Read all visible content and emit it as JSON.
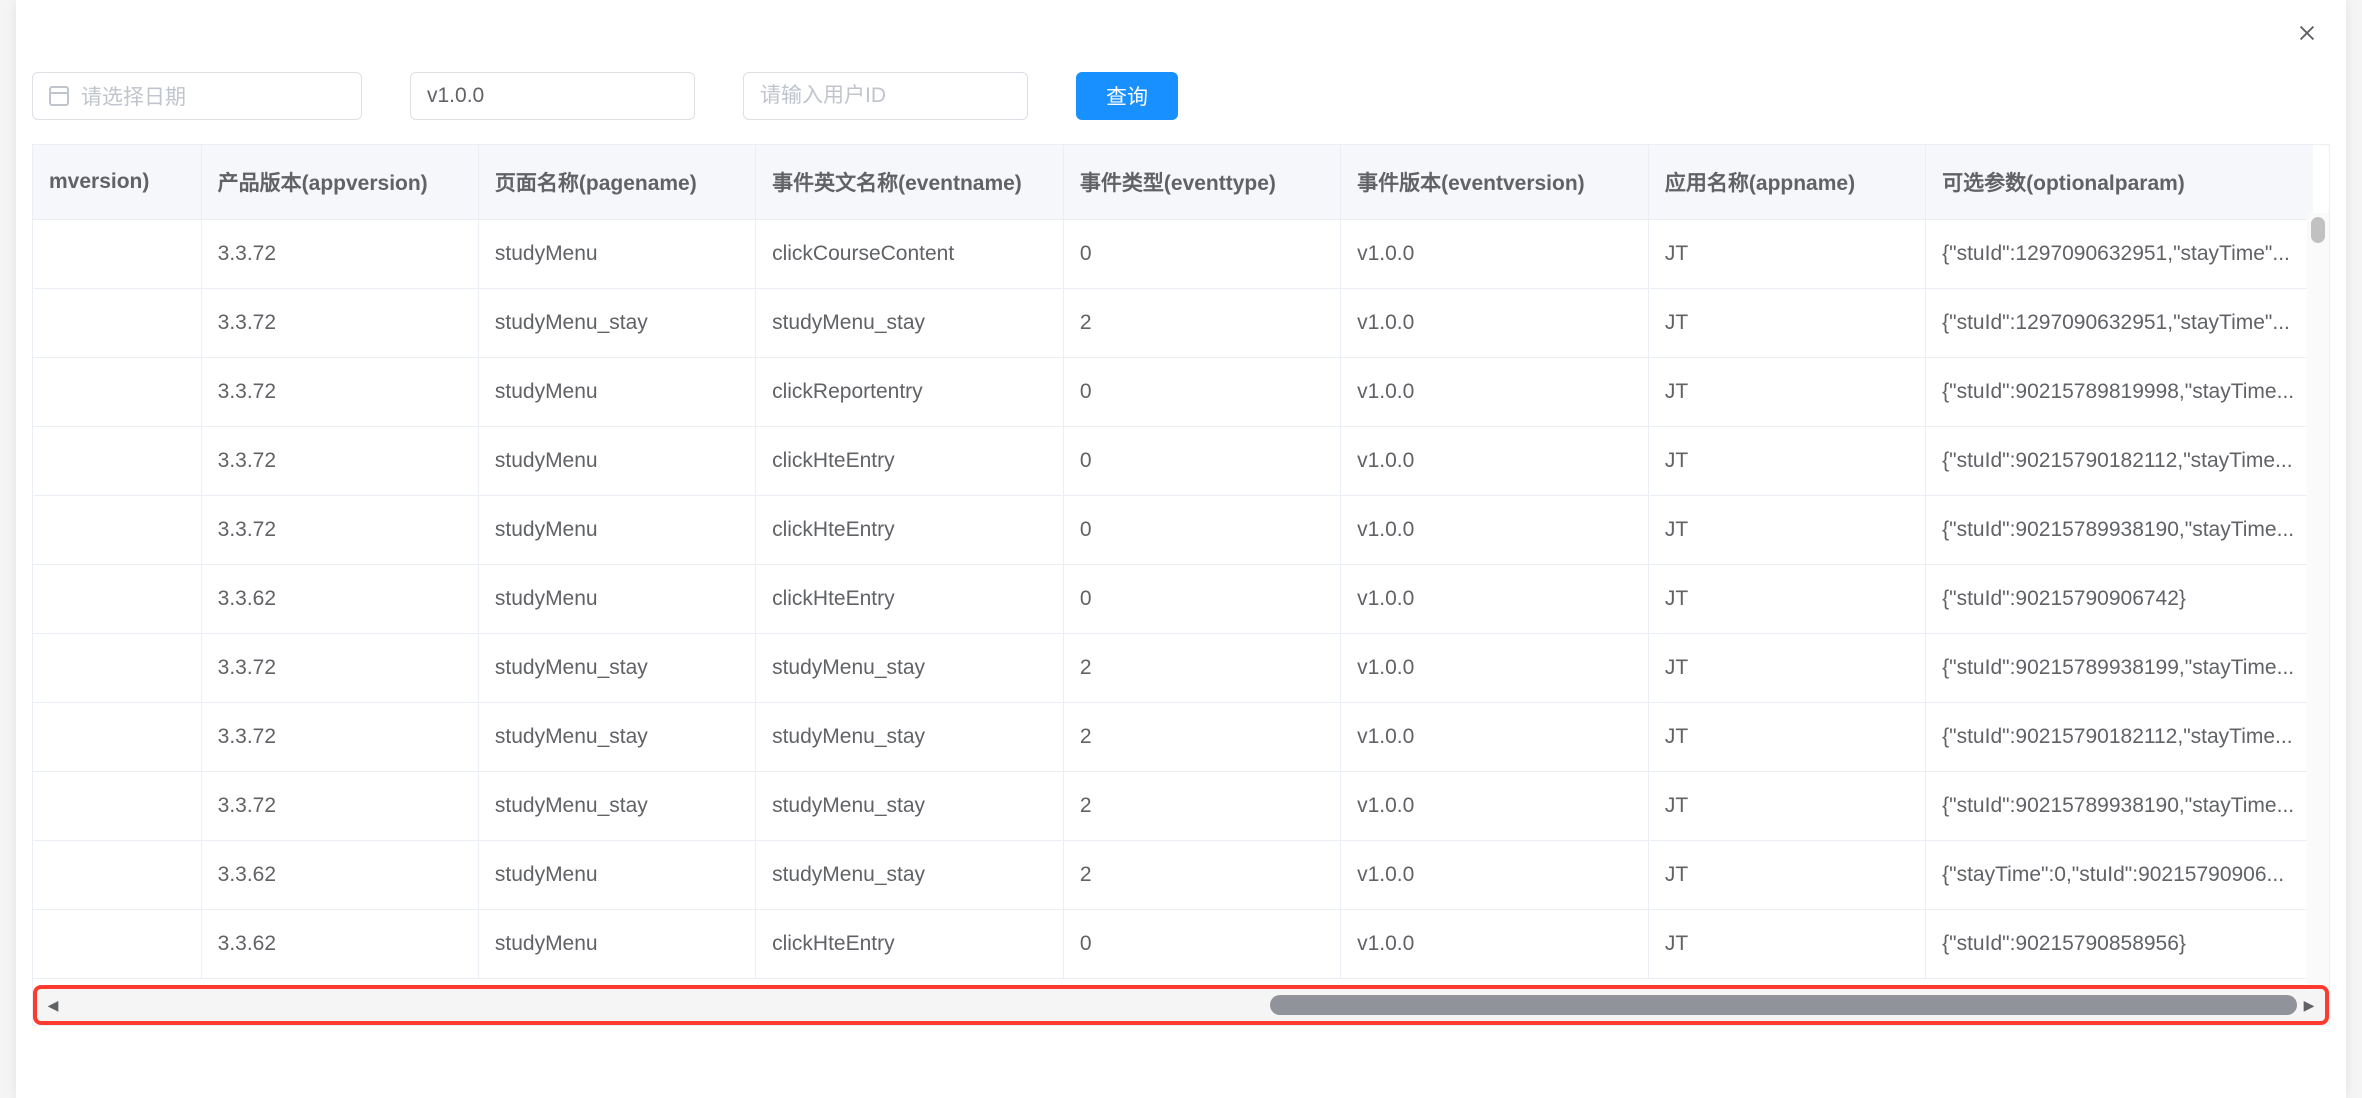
{
  "filters": {
    "date_placeholder": "请选择日期",
    "version_value": "v1.0.0",
    "userid_placeholder": "请输入用户ID",
    "query_label": "查询"
  },
  "columns": {
    "mversion": "mversion)",
    "appversion": "产品版本(appversion)",
    "pagename": "页面名称(pagename)",
    "eventname": "事件英文名称(eventname)",
    "eventtype": "事件类型(eventtype)",
    "eventversion": "事件版本(eventversion)",
    "appname": "应用名称(appname)",
    "optionalparam": "可选参数(optionalparam)"
  },
  "rows": [
    {
      "mversion": "",
      "appversion": "3.3.72",
      "pagename": "studyMenu",
      "eventname": "clickCourseContent",
      "eventtype": "0",
      "eventversion": "v1.0.0",
      "appname": "JT",
      "optionalparam": "{\"stuId\":1297090632951,\"stayTime\"..."
    },
    {
      "mversion": "",
      "appversion": "3.3.72",
      "pagename": "studyMenu_stay",
      "eventname": "studyMenu_stay",
      "eventtype": "2",
      "eventversion": "v1.0.0",
      "appname": "JT",
      "optionalparam": "{\"stuId\":1297090632951,\"stayTime\"..."
    },
    {
      "mversion": "",
      "appversion": "3.3.72",
      "pagename": "studyMenu",
      "eventname": "clickReportentry",
      "eventtype": "0",
      "eventversion": "v1.0.0",
      "appname": "JT",
      "optionalparam": "{\"stuId\":90215789819998,\"stayTime..."
    },
    {
      "mversion": "",
      "appversion": "3.3.72",
      "pagename": "studyMenu",
      "eventname": "clickHteEntry",
      "eventtype": "0",
      "eventversion": "v1.0.0",
      "appname": "JT",
      "optionalparam": "{\"stuId\":90215790182112,\"stayTime..."
    },
    {
      "mversion": "",
      "appversion": "3.3.72",
      "pagename": "studyMenu",
      "eventname": "clickHteEntry",
      "eventtype": "0",
      "eventversion": "v1.0.0",
      "appname": "JT",
      "optionalparam": "{\"stuId\":90215789938190,\"stayTime..."
    },
    {
      "mversion": "",
      "appversion": "3.3.62",
      "pagename": "studyMenu",
      "eventname": "clickHteEntry",
      "eventtype": "0",
      "eventversion": "v1.0.0",
      "appname": "JT",
      "optionalparam": "{\"stuId\":90215790906742}"
    },
    {
      "mversion": "",
      "appversion": "3.3.72",
      "pagename": "studyMenu_stay",
      "eventname": "studyMenu_stay",
      "eventtype": "2",
      "eventversion": "v1.0.0",
      "appname": "JT",
      "optionalparam": "{\"stuId\":90215789938199,\"stayTime..."
    },
    {
      "mversion": "",
      "appversion": "3.3.72",
      "pagename": "studyMenu_stay",
      "eventname": "studyMenu_stay",
      "eventtype": "2",
      "eventversion": "v1.0.0",
      "appname": "JT",
      "optionalparam": "{\"stuId\":90215790182112,\"stayTime..."
    },
    {
      "mversion": "",
      "appversion": "3.3.72",
      "pagename": "studyMenu_stay",
      "eventname": "studyMenu_stay",
      "eventtype": "2",
      "eventversion": "v1.0.0",
      "appname": "JT",
      "optionalparam": "{\"stuId\":90215789938190,\"stayTime..."
    },
    {
      "mversion": "",
      "appversion": "3.3.62",
      "pagename": "studyMenu",
      "eventname": "studyMenu_stay",
      "eventtype": "2",
      "eventversion": "v1.0.0",
      "appname": "JT",
      "optionalparam": "{\"stayTime\":0,\"stuId\":90215790906..."
    },
    {
      "mversion": "",
      "appversion": "3.3.62",
      "pagename": "studyMenu",
      "eventname": "clickHteEntry",
      "eventtype": "0",
      "eventversion": "v1.0.0",
      "appname": "JT",
      "optionalparam": "{\"stuId\":90215790858956}"
    }
  ]
}
